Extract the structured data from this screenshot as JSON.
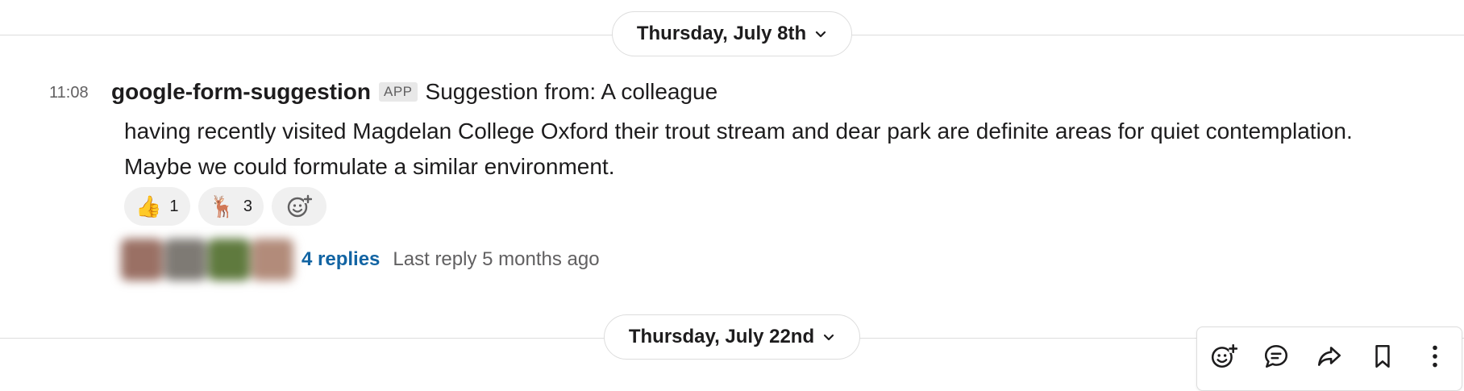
{
  "dividers": [
    {
      "label": "Thursday, July 8th"
    },
    {
      "label": "Thursday, July 22nd"
    }
  ],
  "message": {
    "time": "11:08",
    "author": "google-form-suggestion",
    "badge": "APP",
    "subject": "Suggestion from: A colleague",
    "body_line1": "having recently visited Magdelan College Oxford their trout stream and dear park are definite areas for quiet contemplation.",
    "body_line2": "Maybe we could formulate a similar environment."
  },
  "reactions": [
    {
      "emoji": "👍",
      "icon": "thumbs-up",
      "count": "1"
    },
    {
      "emoji": "🦌",
      "icon": "deer",
      "count": "3"
    }
  ],
  "thread": {
    "replies": "4 replies",
    "last_reply": "Last reply 5 months ago"
  },
  "toolbar": {
    "icons": [
      "add-reaction-icon",
      "reply-thread-icon",
      "share-icon",
      "bookmark-icon",
      "more-actions-icon"
    ]
  },
  "colors": {
    "link": "#1264a3",
    "muted": "#616061",
    "border": "#dddddd"
  }
}
